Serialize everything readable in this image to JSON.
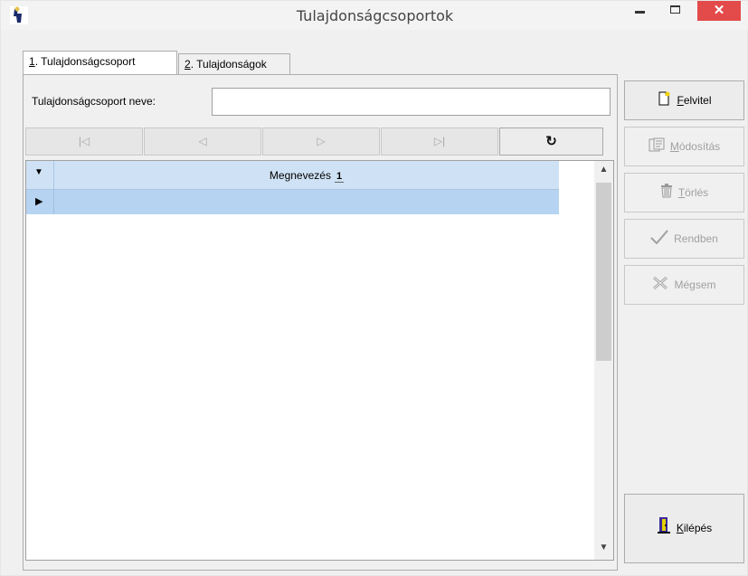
{
  "window": {
    "title": "Tulajdonságcsoportok",
    "close_glyph": "✕"
  },
  "tabs": [
    {
      "key": "1",
      "label": ". Tulajdonságcsoport",
      "active": true
    },
    {
      "key": "2",
      "label": ". Tulajdonságok",
      "active": false
    }
  ],
  "form": {
    "name_label": "Tulajdonságcsoport neve:",
    "name_value": ""
  },
  "navigator": {
    "first": "|◁",
    "prior": "◁",
    "next": "▷",
    "last": "▷|",
    "refresh": "↻"
  },
  "grid": {
    "columns": [
      {
        "title": "Megnevezés",
        "sort_badge": "1"
      }
    ],
    "rows": [
      {
        "Megnevezés": ""
      }
    ],
    "header_indicator": "▼",
    "row_indicator": "▶"
  },
  "side_buttons": {
    "felvitel": {
      "mnemonic": "F",
      "rest": "elvitel",
      "icon": "new-document-icon",
      "enabled": true
    },
    "modositas": {
      "mnemonic": "M",
      "rest": "ódosítás",
      "icon": "edit-document-icon",
      "enabled": false
    },
    "torles": {
      "mnemonic": "T",
      "rest": "örlés",
      "icon": "trash-icon",
      "enabled": false
    },
    "rendben": {
      "label": "Rendben",
      "icon": "checkmark-icon",
      "enabled": false
    },
    "megsem": {
      "label": "Mégsem",
      "icon": "cancel-x-icon",
      "enabled": false
    },
    "kilepes": {
      "mnemonic": "K",
      "rest": "ilépés",
      "icon": "exit-door-icon",
      "enabled": true
    }
  },
  "colors": {
    "close_button": "#e34a4a",
    "grid_header": "#cfe2f5",
    "grid_selected_row": "#b6d4f1"
  }
}
